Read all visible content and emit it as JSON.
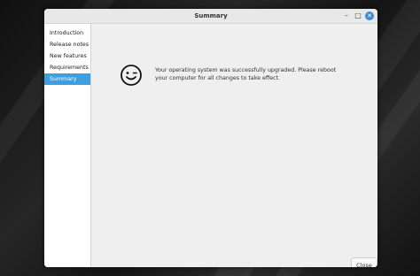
{
  "window": {
    "title": "Summary"
  },
  "sidebar": {
    "items": [
      {
        "label": "Introduction"
      },
      {
        "label": "Release notes"
      },
      {
        "label": "New features"
      },
      {
        "label": "Requirements"
      },
      {
        "label": "Summary",
        "active": true
      }
    ]
  },
  "main": {
    "icon": "winking-face-icon",
    "message": "Your operating system was successfully upgraded. Please reboot your computer for all changes to take effect."
  },
  "footer": {
    "close_label": "Close"
  },
  "colors": {
    "accent": "#3d9ee0",
    "close_button": "#3d8bd8"
  }
}
